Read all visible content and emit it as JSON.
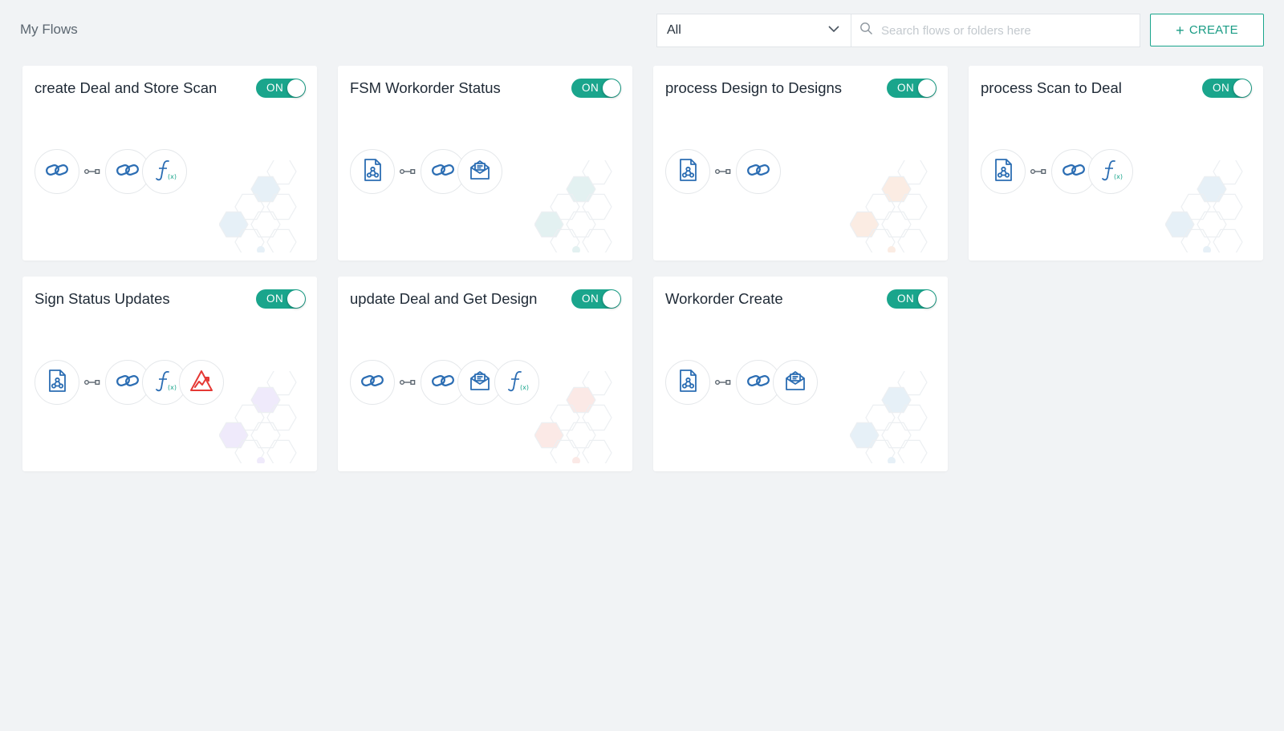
{
  "header": {
    "title": "My Flows",
    "filter": {
      "selected": "All"
    },
    "search": {
      "placeholder": "Search flows or folders here",
      "value": ""
    },
    "create_label": "CREATE",
    "create_plus": "+"
  },
  "colors": {
    "accent": "#1aa58c",
    "icon_blue": "#2b6db3",
    "icon_teal": "#1aa58c",
    "icon_red": "#e53935",
    "background": "#f1f3f5"
  },
  "flows": [
    {
      "title": "create Deal and Store Scan",
      "status": "ON",
      "trigger": "link-icon",
      "actions": [
        "link-icon",
        "function-icon"
      ],
      "deco": "#e6f0f7"
    },
    {
      "title": "FSM Workorder Status",
      "status": "ON",
      "trigger": "webhook-document-icon",
      "actions": [
        "link-icon",
        "mail-icon"
      ],
      "deco": "#e3f1f1"
    },
    {
      "title": "process Design to Designs",
      "status": "ON",
      "trigger": "webhook-document-icon",
      "actions": [
        "link-icon"
      ],
      "deco": "#fbece3"
    },
    {
      "title": "process Scan to Deal",
      "status": "ON",
      "trigger": "webhook-document-icon",
      "actions": [
        "link-icon",
        "function-icon"
      ],
      "deco": "#e6f0f7"
    },
    {
      "title": "Sign Status Updates",
      "status": "ON",
      "trigger": "webhook-document-icon",
      "actions": [
        "link-icon",
        "function-icon",
        "chart-alert-icon"
      ],
      "deco": "#efeafb"
    },
    {
      "title": "update Deal and Get Design",
      "status": "ON",
      "trigger": "link-icon",
      "actions": [
        "link-icon",
        "mail-icon",
        "function-icon"
      ],
      "deco": "#fbe9e6"
    },
    {
      "title": "Workorder Create",
      "status": "ON",
      "trigger": "webhook-document-icon",
      "actions": [
        "link-icon",
        "mail-icon"
      ],
      "deco": "#e6f0f7"
    }
  ]
}
